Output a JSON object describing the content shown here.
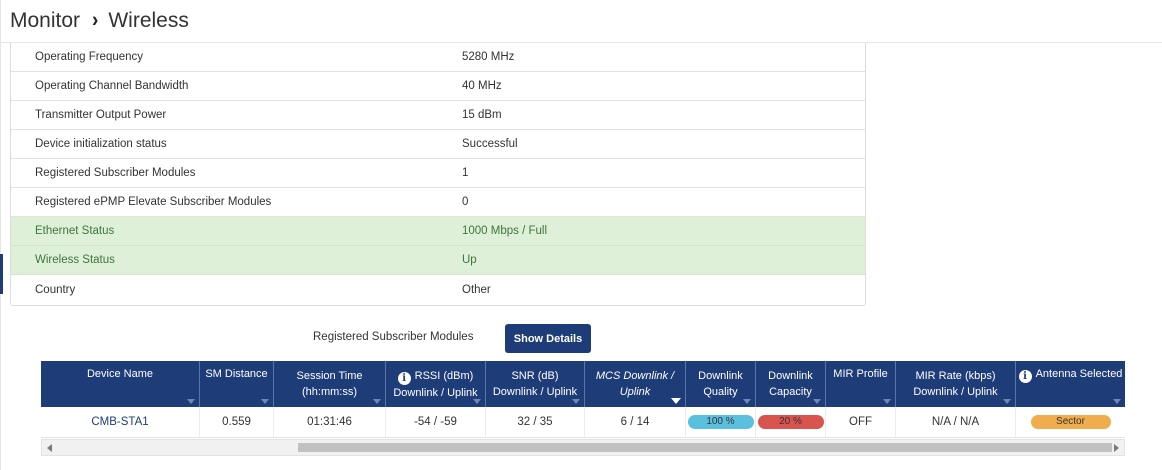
{
  "breadcrumb": {
    "root": "Monitor",
    "separator": "›",
    "current": "Wireless"
  },
  "status_rows": [
    {
      "label": "Operating Frequency",
      "value": "5280 MHz",
      "state": "normal"
    },
    {
      "label": "Operating Channel Bandwidth",
      "value": "40 MHz",
      "state": "normal"
    },
    {
      "label": "Transmitter Output Power",
      "value": "15 dBm",
      "state": "normal"
    },
    {
      "label": "Device initialization status",
      "value": "Successful",
      "state": "normal"
    },
    {
      "label": "Registered Subscriber Modules",
      "value": "1",
      "state": "normal"
    },
    {
      "label": "Registered ePMP Elevate Subscriber Modules",
      "value": "0",
      "state": "normal"
    },
    {
      "label": "Ethernet Status",
      "value": "1000 Mbps / Full",
      "state": "ok"
    },
    {
      "label": "Wireless Status",
      "value": "Up",
      "state": "ok"
    },
    {
      "label": "Country",
      "value": "Other",
      "state": "normal"
    }
  ],
  "sm_section": {
    "caption": "Registered Subscriber Modules",
    "show_details_label": "Show Details"
  },
  "grid": {
    "columns": [
      {
        "label": "Device Name"
      },
      {
        "label": "SM Distance"
      },
      {
        "label": "Session Time (hh:mm:ss)"
      },
      {
        "label": "RSSI (dBm) Downlink / Uplink",
        "icon": "info-icon"
      },
      {
        "label": "SNR (dB) Downlink / Uplink"
      },
      {
        "label": "MCS Downlink / Uplink",
        "sorted": true
      },
      {
        "label": "Downlink Quality"
      },
      {
        "label": "Downlink Capacity"
      },
      {
        "label": "MIR Profile"
      },
      {
        "label": "MIR Rate (kbps) Downlink / Uplink"
      },
      {
        "label": "Antenna Selected",
        "icon": "info-icon"
      }
    ],
    "rows": [
      {
        "device_name": "CMB-STA1",
        "sm_distance": "0.559",
        "session_time": "01:31:46",
        "rssi": "-54 / -59",
        "snr": "32 / 35",
        "mcs": "6 / 14",
        "downlink_quality": "100 %",
        "downlink_capacity": "20 %",
        "mir_profile": "OFF",
        "mir_rate": "N/A / N/A",
        "antenna_selected": "Sector"
      }
    ]
  },
  "colors": {
    "brand_navy": "#1e3c78",
    "status_ok_bg": "#dff0d8",
    "status_ok_text": "#3c763d",
    "quality_pill": "#5bc0de",
    "capacity_pill": "#d9534f",
    "antenna_pill": "#f0ad4e"
  }
}
